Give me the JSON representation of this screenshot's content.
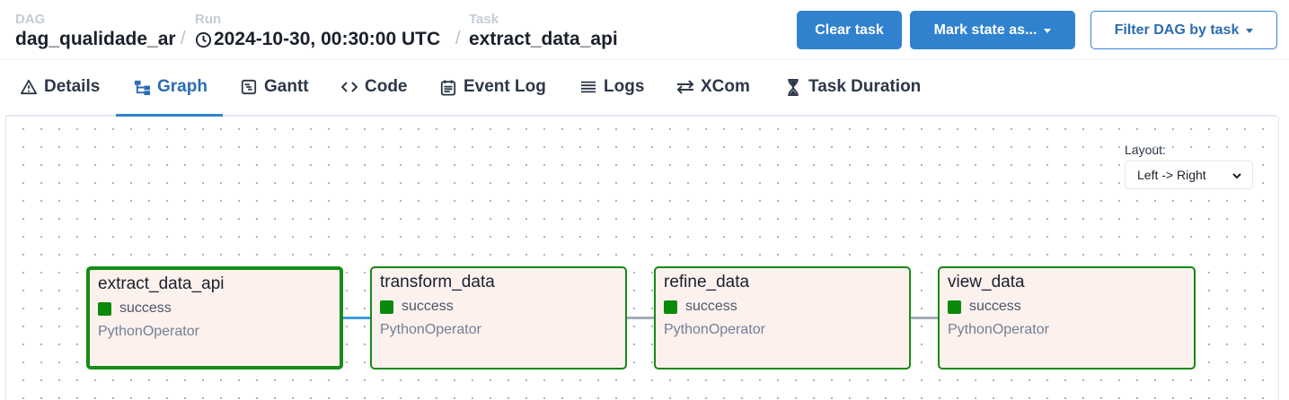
{
  "breadcrumb": {
    "dag": {
      "label": "DAG",
      "value": "dag_qualidade_ar"
    },
    "run": {
      "label": "Run",
      "value": "2024-10-30, 00:30:00 UTC"
    },
    "task": {
      "label": "Task",
      "value": "extract_data_api"
    },
    "separator": "/"
  },
  "actions": {
    "clear_task": "Clear task",
    "mark_state": "Mark state as...",
    "filter_dag": "Filter DAG by task"
  },
  "tabs": [
    {
      "label": "Details",
      "icon": "warning-triangle-icon"
    },
    {
      "label": "Graph",
      "icon": "graph-icon",
      "active": true
    },
    {
      "label": "Gantt",
      "icon": "gantt-icon"
    },
    {
      "label": "Code",
      "icon": "code-icon"
    },
    {
      "label": "Event Log",
      "icon": "event-log-icon"
    },
    {
      "label": "Logs",
      "icon": "logs-icon"
    },
    {
      "label": "XCom",
      "icon": "xcom-icon"
    },
    {
      "label": "Task Duration",
      "icon": "hourglass-icon"
    }
  ],
  "layout": {
    "label": "Layout:",
    "value": "Left -> Right"
  },
  "nodes": [
    {
      "name": "extract_data_api",
      "status": "success",
      "operator": "PythonOperator",
      "selected": true
    },
    {
      "name": "transform_data",
      "status": "success",
      "operator": "PythonOperator"
    },
    {
      "name": "refine_data",
      "status": "success",
      "operator": "PythonOperator"
    },
    {
      "name": "view_data",
      "status": "success",
      "operator": "PythonOperator"
    }
  ],
  "colors": {
    "accent": "#3182ce",
    "success": "#008000",
    "node_bg": "#fdf1ee",
    "edge_active": "#3d9be0",
    "edge": "#a3adb8"
  }
}
